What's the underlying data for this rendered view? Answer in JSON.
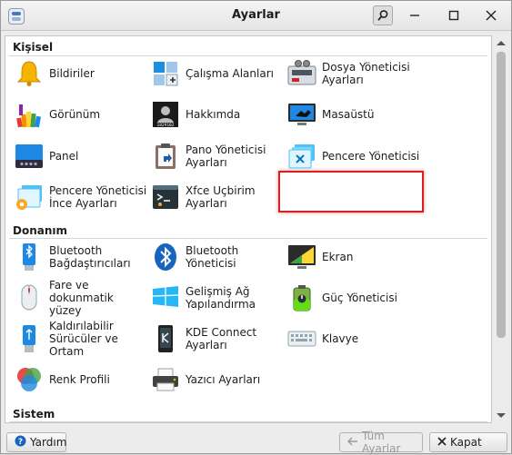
{
  "window": {
    "title": "Ayarlar"
  },
  "sections": [
    {
      "title": "Kişisel"
    },
    {
      "title": "Donanım"
    },
    {
      "title": "Sistem"
    }
  ],
  "personal": [
    {
      "label": "Bildiriler",
      "icon": "bell-icon"
    },
    {
      "label": "Çalışma Alanları",
      "icon": "workspaces-icon"
    },
    {
      "label": "Dosya Yöneticisi\nAyarları",
      "icon": "file-manager-icon"
    },
    {
      "label": "Görünüm",
      "icon": "appearance-icon"
    },
    {
      "label": "Hakkımda",
      "icon": "about-me-icon"
    },
    {
      "label": "Masaüstü",
      "icon": "desktop-icon"
    },
    {
      "label": "Panel",
      "icon": "panel-icon"
    },
    {
      "label": "Pano Yöneticisi\nAyarları",
      "icon": "clipboard-icon"
    },
    {
      "label": "Pencere Yöneticisi",
      "icon": "window-manager-icon"
    },
    {
      "label": "Pencere Yöneticisi\nİnce Ayarları",
      "icon": "window-tweaks-icon"
    },
    {
      "label": "Xfce Uçbirim\nAyarları",
      "icon": "terminal-icon"
    }
  ],
  "hardware": [
    {
      "label": "Bluetooth\nBağdaştırıcıları",
      "icon": "bluetooth-adapter-icon"
    },
    {
      "label": "Bluetooth Yöneticisi",
      "icon": "bluetooth-icon"
    },
    {
      "label": "Ekran",
      "icon": "display-icon"
    },
    {
      "label": "Fare ve\ndokunmatik yüzey",
      "icon": "mouse-icon"
    },
    {
      "label": "Gelişmiş Ağ\nYapılandırma",
      "icon": "network-icon"
    },
    {
      "label": "Güç Yöneticisi",
      "icon": "power-icon"
    },
    {
      "label": "Kaldırılabilir\nSürücüler ve Ortam",
      "icon": "usb-icon"
    },
    {
      "label": "KDE Connect\nAyarları",
      "icon": "kde-connect-icon"
    },
    {
      "label": "Klavye",
      "icon": "keyboard-icon"
    },
    {
      "label": "Renk Profili",
      "icon": "color-profile-icon"
    },
    {
      "label": "Yazıcı Ayarları",
      "icon": "printer-icon"
    }
  ],
  "buttons": {
    "help": "Yardım",
    "all_settings": "Tüm Ayarlar",
    "close": "Kapat"
  },
  "icon_label_photo": "1829102",
  "colors": {
    "highlight": "#d92020"
  }
}
